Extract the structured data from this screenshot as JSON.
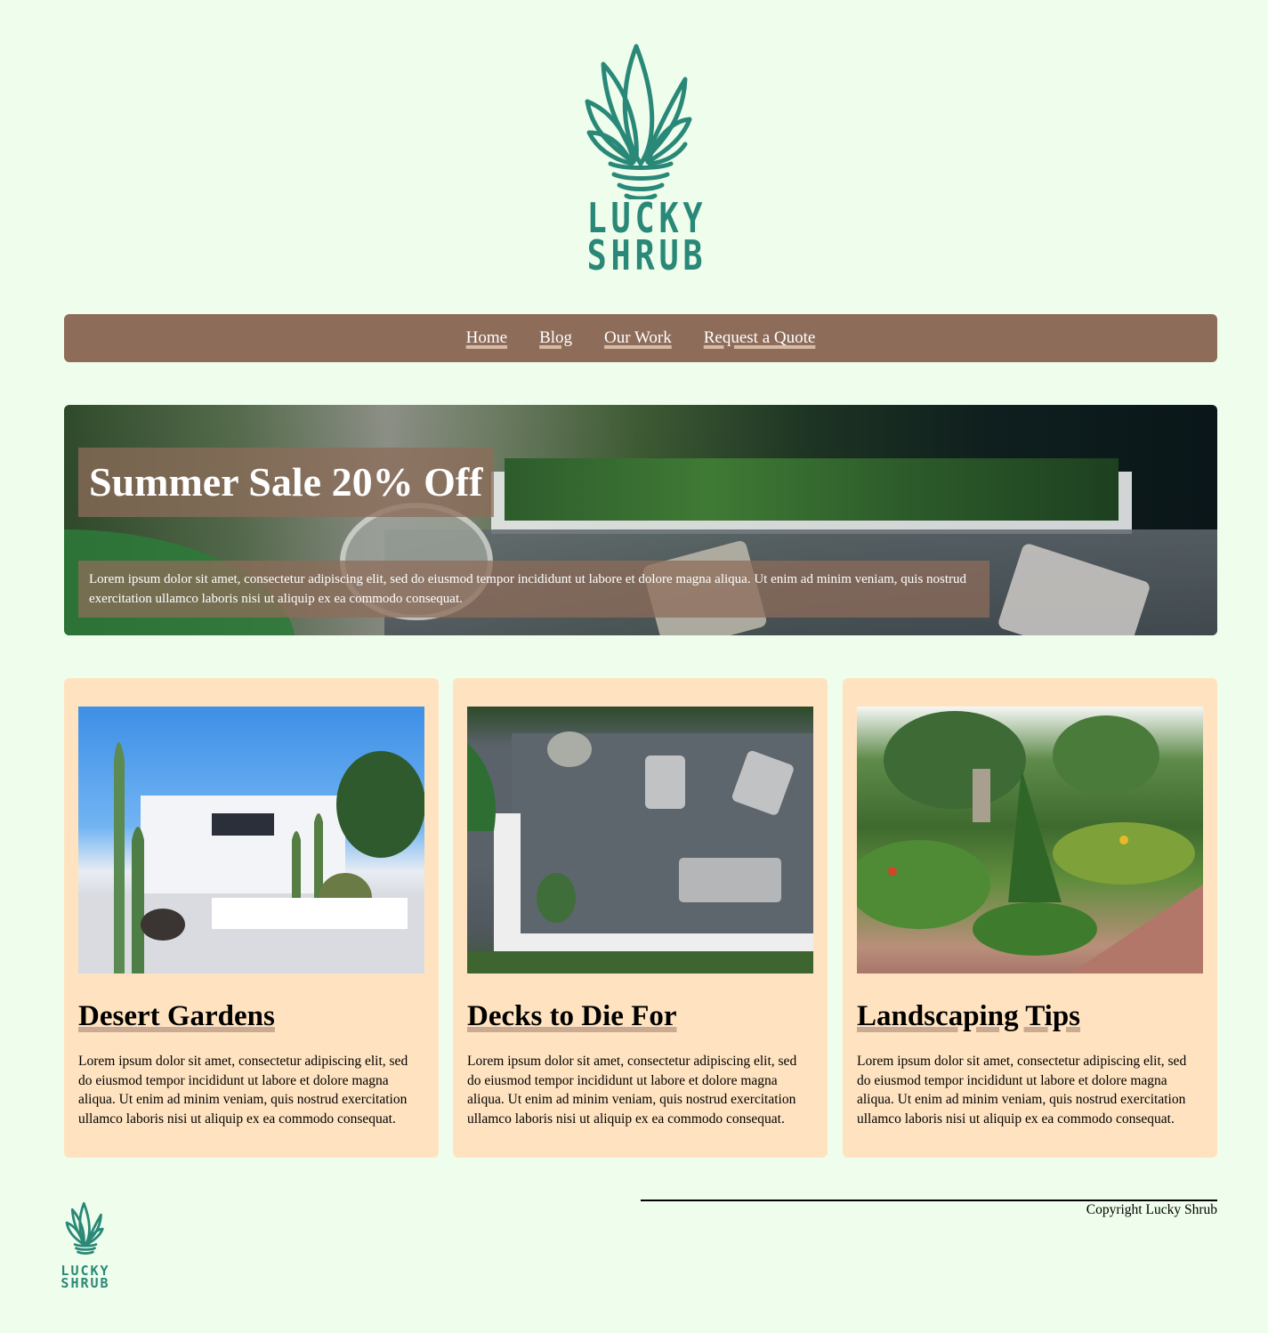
{
  "brand": {
    "line1": "LUCKY",
    "line2": "SHRUB"
  },
  "nav": [
    {
      "label": "Home"
    },
    {
      "label": "Blog"
    },
    {
      "label": "Our Work"
    },
    {
      "label": "Request a Quote"
    }
  ],
  "hero": {
    "title": "Summer Sale 20% Off",
    "text": "Lorem ipsum dolor sit amet, consectetur adipiscing elit, sed do eiusmod tempor incididunt ut labore et dolore magna aliqua. Ut enim ad minim veniam, quis nostrud exercitation ullamco laboris nisi ut aliquip ex ea commodo consequat."
  },
  "cards": [
    {
      "title": "Desert Gardens",
      "text": "Lorem ipsum dolor sit amet, consectetur adipiscing elit, sed do eiusmod tempor incididunt ut labore et dolore magna aliqua. Ut enim ad minim veniam, quis nostrud exercitation ullamco laboris nisi ut aliquip ex ea commodo consequat."
    },
    {
      "title": "Decks to Die For",
      "text": "Lorem ipsum dolor sit amet, consectetur adipiscing elit, sed do eiusmod tempor incididunt ut labore et dolore magna aliqua. Ut enim ad minim veniam, quis nostrud exercitation ullamco laboris nisi ut aliquip ex ea commodo consequat."
    },
    {
      "title": "Landscaping Tips",
      "text": "Lorem ipsum dolor sit amet, consectetur adipiscing elit, sed do eiusmod tempor incididunt ut labore et dolore magna aliqua. Ut enim ad minim veniam, quis nostrud exercitation ullamco laboris nisi ut aliquip ex ea commodo consequat."
    }
  ],
  "footer": {
    "copyright": "Copyright Lucky Shrub"
  },
  "colors": {
    "background": "#effeec",
    "nav": "#8e6c5a",
    "card": "#ffe3c0",
    "brand": "#2a8878",
    "underline": "#c9ab93"
  }
}
